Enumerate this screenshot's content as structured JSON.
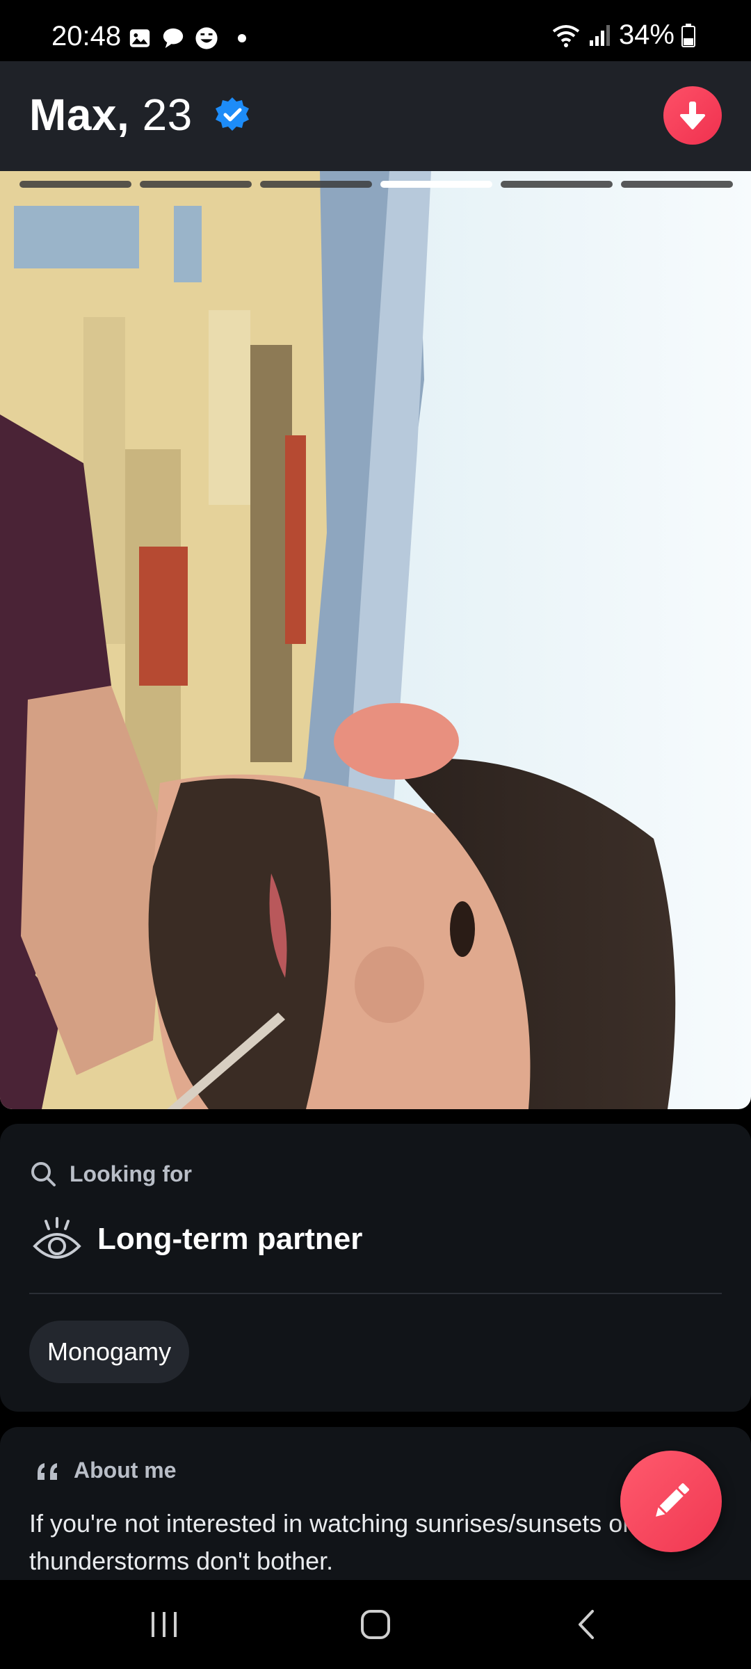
{
  "status_bar": {
    "time": "20:48",
    "battery": "34%",
    "left_icons": [
      "gallery-icon",
      "chat-bubble-icon",
      "smiley-icon",
      "dot-icon"
    ],
    "right_icons": [
      "wifi-icon",
      "signal-icon",
      "battery-icon"
    ]
  },
  "profile": {
    "name": "Max,",
    "age": "23",
    "verified": true
  },
  "photo": {
    "total": 6,
    "current": 4
  },
  "looking_for": {
    "label": "Looking for",
    "value": "Long-term partner",
    "chip": "Monogamy"
  },
  "about_me": {
    "label": "About me",
    "text": "If you're not interested in watching sunrises/sunsets or thunderstorms don't bother."
  },
  "colors": {
    "accent": "#fd5067",
    "verified_blue": "#1d8cf8",
    "header_bg": "#1f2228",
    "card_bg": "#111418"
  },
  "nav": {
    "items": [
      "recents-icon",
      "home-icon",
      "back-icon"
    ]
  }
}
